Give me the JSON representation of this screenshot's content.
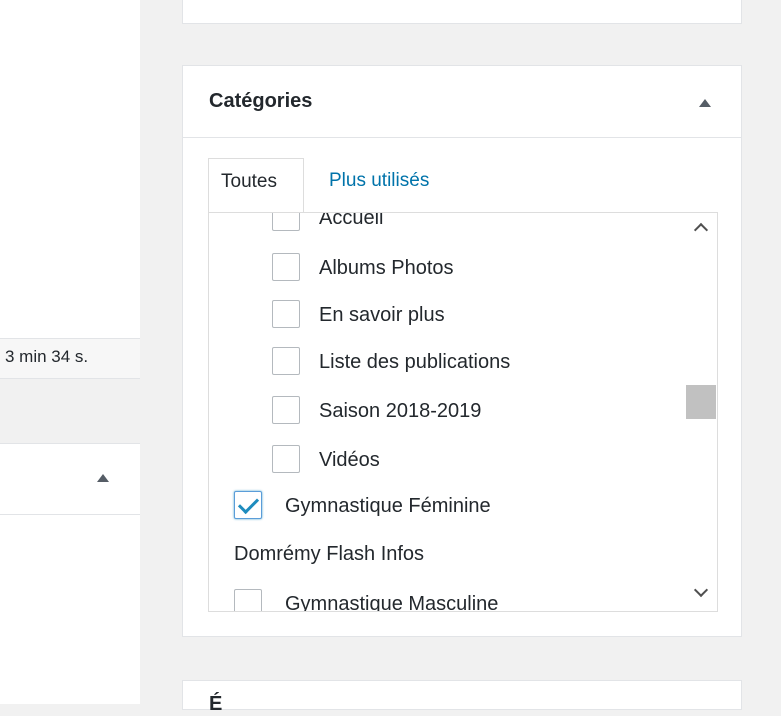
{
  "status": {
    "duration": "3 min 34 s."
  },
  "categories": {
    "title": "Catégories",
    "tabs": {
      "all": "Toutes",
      "popular": "Plus utilisés"
    },
    "items": [
      {
        "label": "Accueil",
        "checked": false,
        "level": 1
      },
      {
        "label": "Albums Photos",
        "checked": false,
        "level": 1
      },
      {
        "label": "En savoir plus",
        "checked": false,
        "level": 1
      },
      {
        "label": "Liste des publications",
        "checked": false,
        "level": 1
      },
      {
        "label": "Saison 2018-2019",
        "checked": false,
        "level": 1
      },
      {
        "label": "Vidéos",
        "checked": false,
        "level": 1
      },
      {
        "label": "Gymnastique Féminine",
        "checked": true,
        "level": 0
      },
      {
        "label": "Domrémy Flash Infos",
        "level": 0,
        "no_checkbox": true
      },
      {
        "label": "Gymnastique Masculine",
        "checked": false,
        "level": 0
      }
    ]
  },
  "bottom_panel": {
    "title_peek": "É"
  }
}
